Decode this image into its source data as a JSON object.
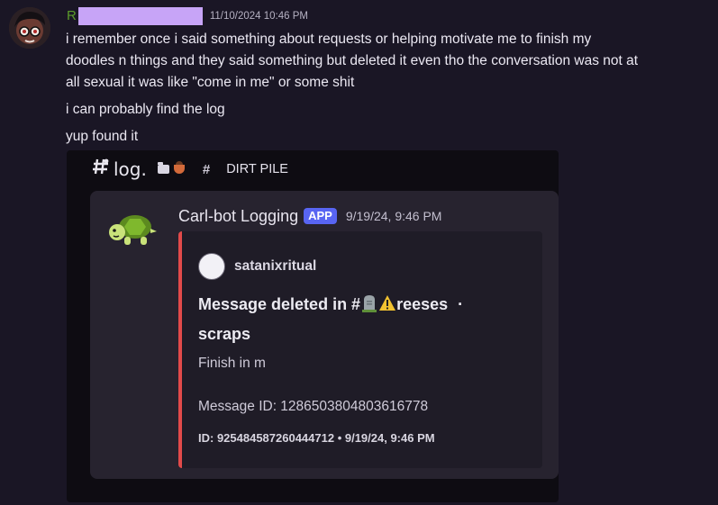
{
  "message": {
    "username_visible": "R",
    "timestamp": "11/10/2024 10:46 PM",
    "lines": [
      "i remember once i said something about requests or helping motivate me to finish my",
      "doodles n things and they said something but deleted it  even tho the conversation was not at",
      "all sexual it was like \"come in me\" or some shit",
      "i can probably find the log",
      "yup found it"
    ]
  },
  "screenshot": {
    "channel_name": "log.",
    "channel_separator": "#",
    "category": "DIRT PILE",
    "bot_name": "Carl-bot Logging",
    "app_badge": "APP",
    "bot_timestamp": "9/19/24, 9:46 PM",
    "embed": {
      "author": "satanixritual",
      "title_part1": "Message deleted in #",
      "title_part2": "reeses",
      "title_dot": "·",
      "title_line2": "scraps",
      "description": "Finish in m",
      "message_id": "Message ID: 1286503804803616778",
      "footer": "ID: 925484587260444712 • 9/19/24, 9:46 PM",
      "accent_color": "#e24a4a"
    }
  },
  "colors": {
    "username": "#5b9b2b",
    "app_badge": "#5865f2",
    "redaction": "#c7a4f7"
  },
  "icons": [
    "user-avatar",
    "hashtag-icon",
    "folder-icon",
    "bowl-emoji-icon",
    "turtle-avatar-icon",
    "headstone-emoji-icon",
    "warning-emoji-icon"
  ]
}
